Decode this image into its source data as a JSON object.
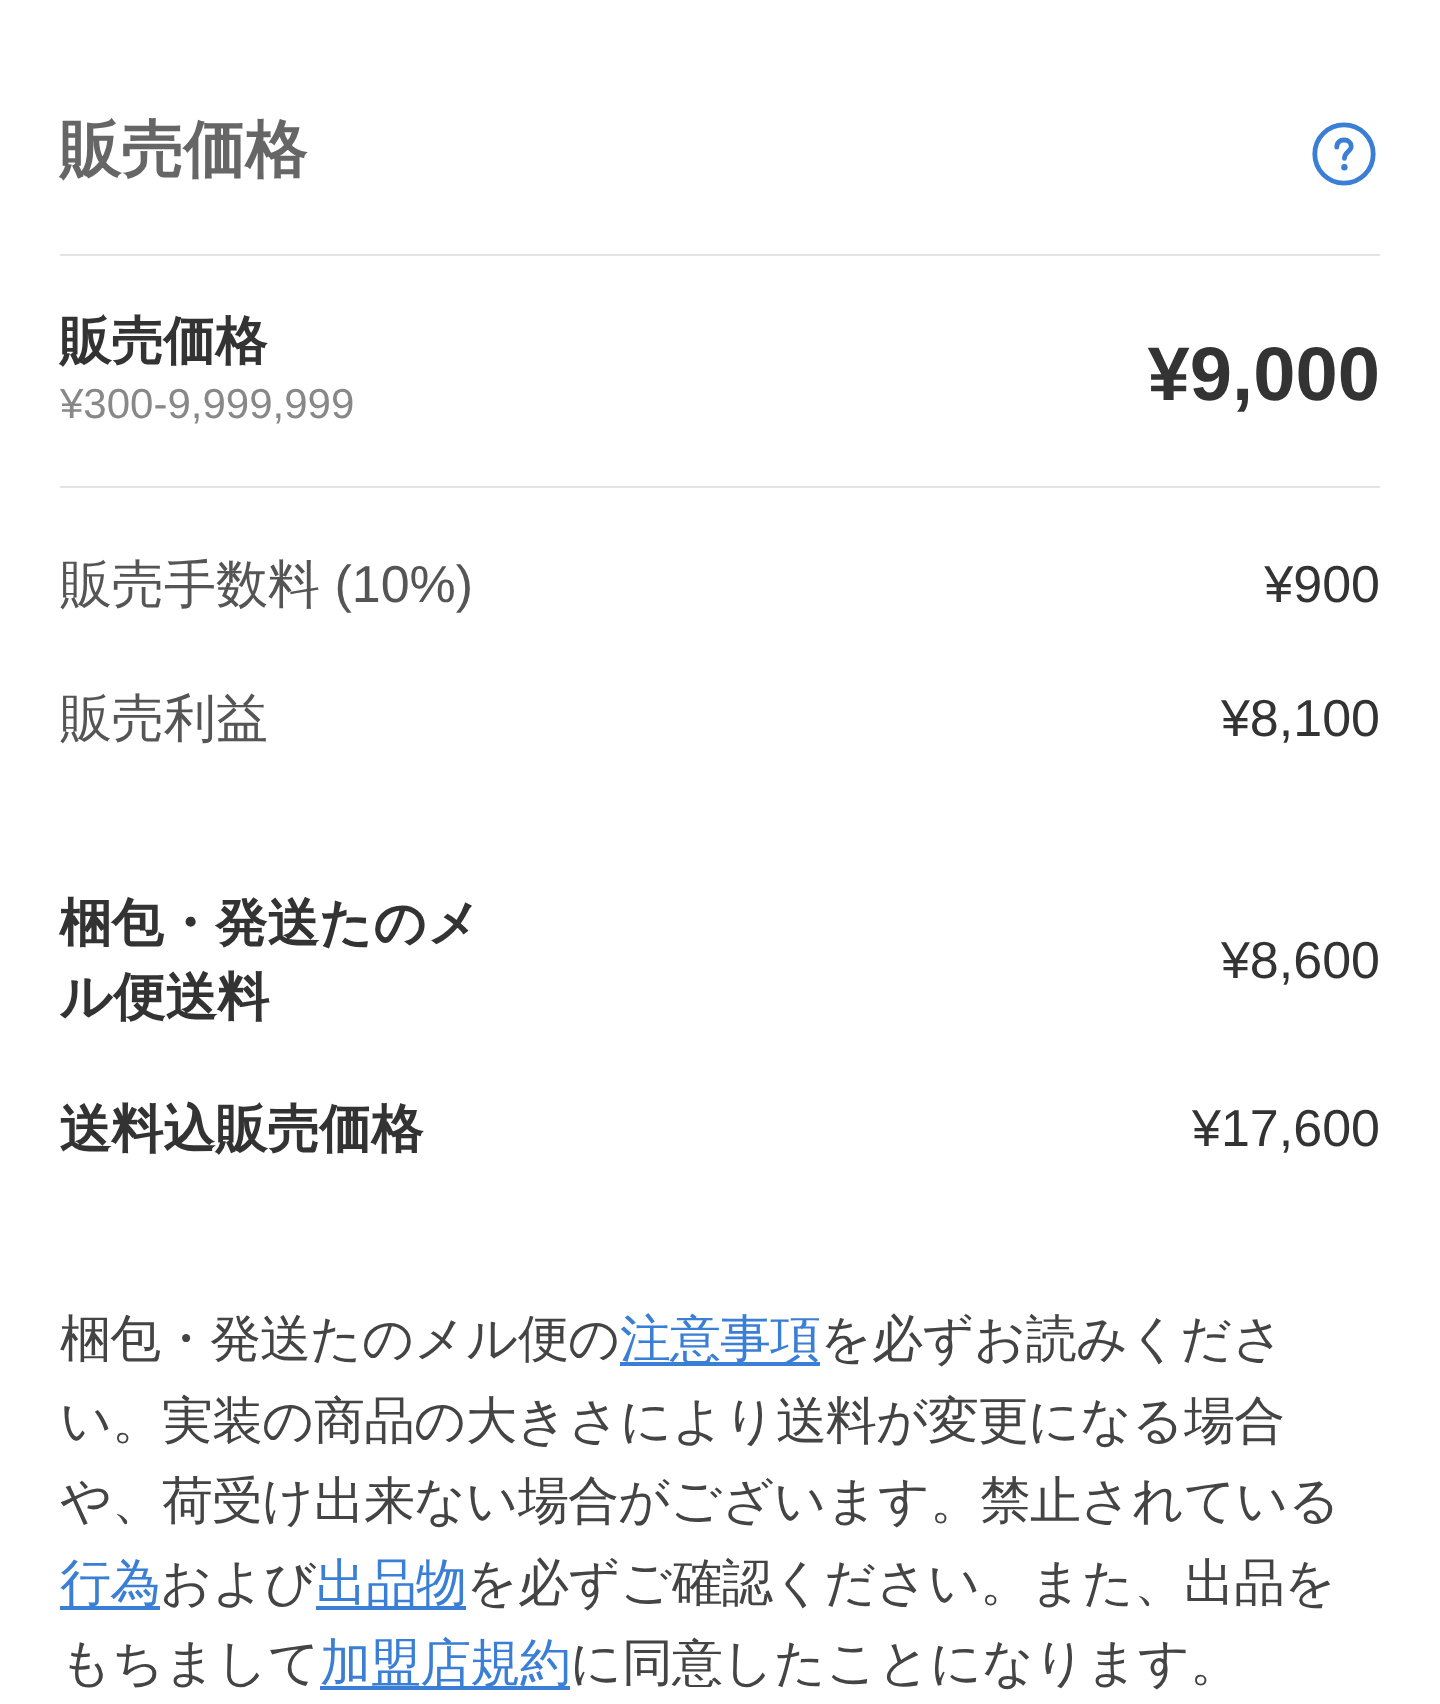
{
  "header": {
    "title": "販売価格"
  },
  "price": {
    "label": "販売価格",
    "range": "¥300-9,999,999",
    "value": "¥9,000"
  },
  "fee_rows": [
    {
      "label": "販売手数料 (10%)",
      "value": "¥900"
    },
    {
      "label": "販売利益",
      "value": "¥8,100"
    }
  ],
  "shipping_rows": [
    {
      "label": "梱包・発送たのメル便送料",
      "value": "¥8,600"
    },
    {
      "label": "送料込販売価格",
      "value": "¥17,600"
    }
  ],
  "notice": [
    {
      "kind": "text",
      "text": "梱包・発送たのメル便の"
    },
    {
      "kind": "link",
      "text": "注意事項"
    },
    {
      "kind": "text",
      "text": "を必ずお読みください。実装の商品の大きさにより送料が変更になる場合や、荷受け出来ない場合がございます。禁止されている"
    },
    {
      "kind": "link",
      "text": "行為"
    },
    {
      "kind": "text",
      "text": "および"
    },
    {
      "kind": "link",
      "text": "出品物"
    },
    {
      "kind": "text",
      "text": "を必ずご確認ください。また、出品をもちまして"
    },
    {
      "kind": "link",
      "text": "加盟店規約"
    },
    {
      "kind": "text",
      "text": "に同意したことになります。"
    }
  ]
}
